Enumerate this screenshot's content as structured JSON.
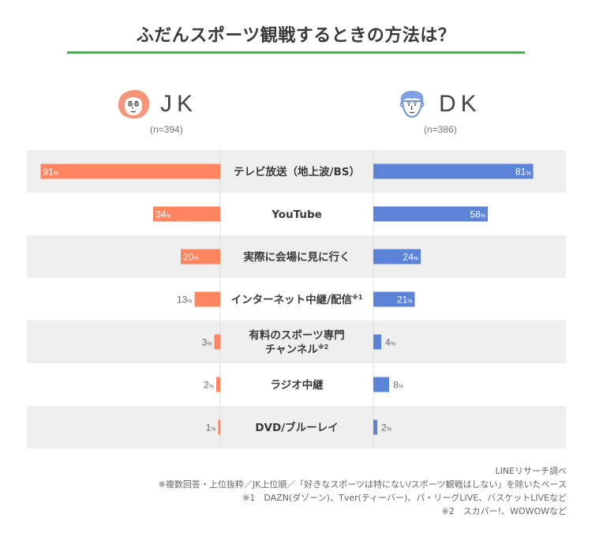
{
  "title": "ふだんスポーツ観戦するときの方法は？",
  "groups": {
    "left": {
      "name": "JK",
      "n": "(n=394)",
      "color": "#ff8560",
      "icon": "girl-face-icon"
    },
    "right": {
      "name": "DK",
      "n": "(n=386)",
      "color": "#5b84d8",
      "icon": "boy-face-icon"
    }
  },
  "colors": {
    "accent_rule": "#2fbd3a",
    "row_band": "#efefef"
  },
  "footnotes": [
    "LINEリサーチ調べ",
    "※複数回答・上位抜粋／JK上位順／「好きなスポーツは特にない/スポーツ観戦はしない」を除いたベース",
    "※1　DAZN(ダゾーン)、Tver(ティーバー)、パ・リーグLIVE、バスケットLIVEなど",
    "※2　スカパー!、WOWOWなど"
  ],
  "chart_data": {
    "type": "bar",
    "orientation": "horizontal-butterfly",
    "title": "ふだんスポーツ観戦するときの方法は？",
    "unit": "%",
    "categories": [
      [
        "テレビ放送（地上波/BS）"
      ],
      [
        "YouTube"
      ],
      [
        "実際に会場に見に行く"
      ],
      [
        "インターネット中継/配信※1"
      ],
      [
        "有料のスポーツ専門",
        "チャンネル※2"
      ],
      [
        "ラジオ中継"
      ],
      [
        "DVD/ブルーレイ"
      ]
    ],
    "series": [
      {
        "name": "JK",
        "n": 394,
        "side": "left",
        "values": [
          91,
          34,
          20,
          13,
          3,
          2,
          1
        ]
      },
      {
        "name": "DK",
        "n": 386,
        "side": "right",
        "values": [
          81,
          58,
          24,
          21,
          4,
          8,
          2
        ]
      }
    ],
    "xlim": [
      0,
      100
    ],
    "grid": false,
    "legend": "top"
  }
}
